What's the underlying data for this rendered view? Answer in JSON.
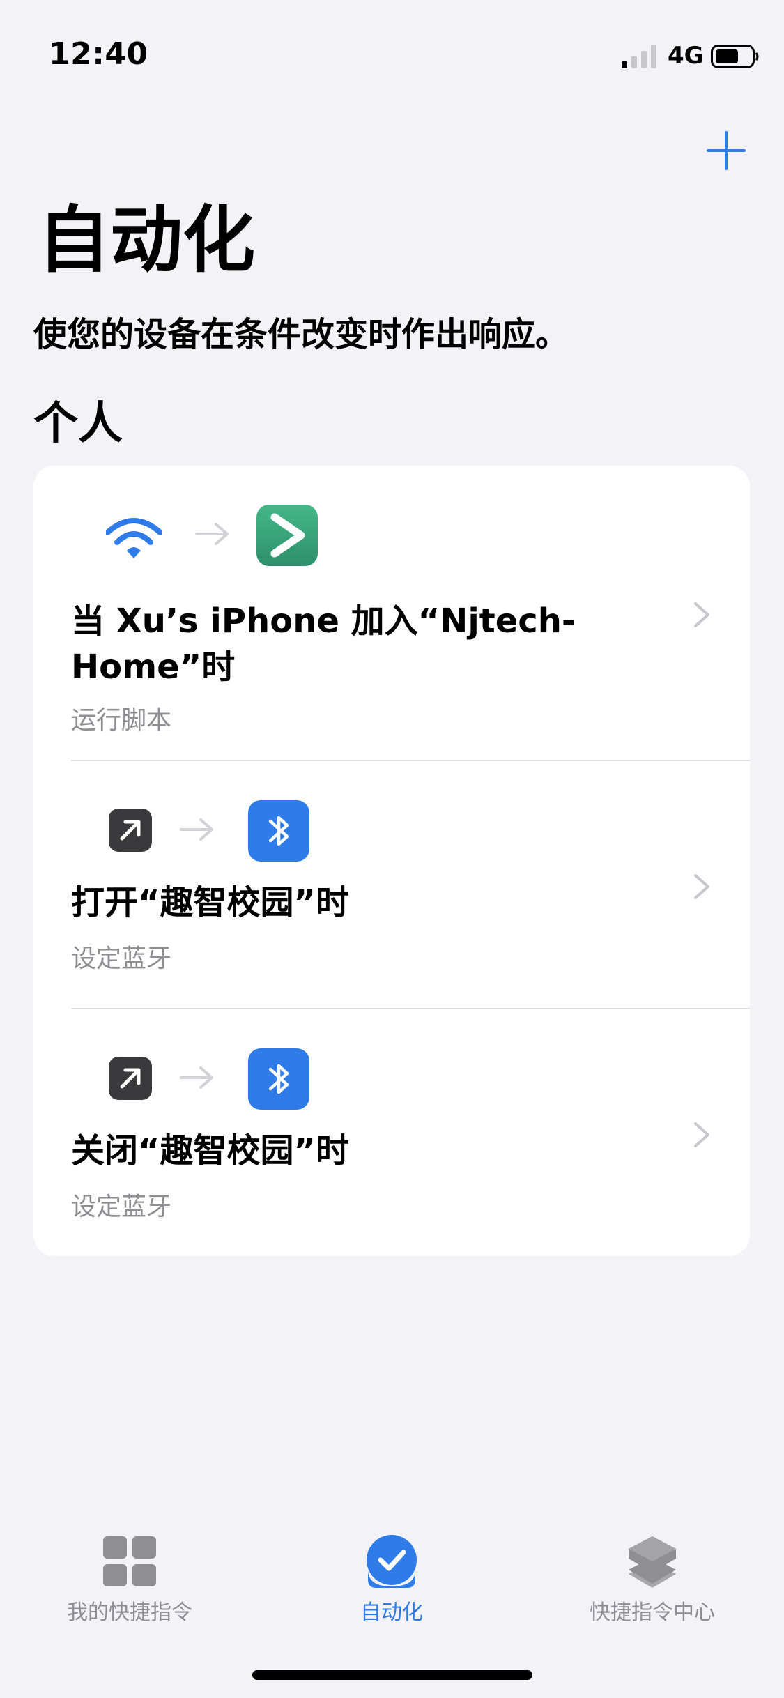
{
  "status_bar": {
    "time": "12:40",
    "network": "4G",
    "battery_level": 0.65,
    "signal_bars": 1
  },
  "header": {
    "add_icon": "plus-icon",
    "title": "自动化",
    "subtitle": "使您的设备在条件改变时作出响应。"
  },
  "section": {
    "title": "个人"
  },
  "automations": [
    {
      "trigger_icon": "wifi-icon",
      "action_icon": "run-script-icon",
      "title": "当 Xu’s iPhone 加入“Njtech-Home”时",
      "subtitle": "运行脚本"
    },
    {
      "trigger_icon": "app-open-icon",
      "action_icon": "bluetooth-icon",
      "title": "打开“趣智校园”时",
      "subtitle": "设定蓝牙"
    },
    {
      "trigger_icon": "app-open-icon",
      "action_icon": "bluetooth-icon",
      "title": "关闭“趣智校园”时",
      "subtitle": "设定蓝牙"
    }
  ],
  "tab_bar": {
    "tabs": [
      {
        "label": "我的快捷指令",
        "icon": "grid-icon",
        "active": false
      },
      {
        "label": "自动化",
        "icon": "checkmark-clock-icon",
        "active": true
      },
      {
        "label": "快捷指令中心",
        "icon": "layers-icon",
        "active": false
      }
    ]
  },
  "colors": {
    "accent": "#2f7ce8",
    "background": "#f2f2f7",
    "script_green": "#3aa57f",
    "bluetooth_blue": "#2f7ce8",
    "dark_icon": "#3a3a3c",
    "secondary_text": "#8e8e93"
  }
}
